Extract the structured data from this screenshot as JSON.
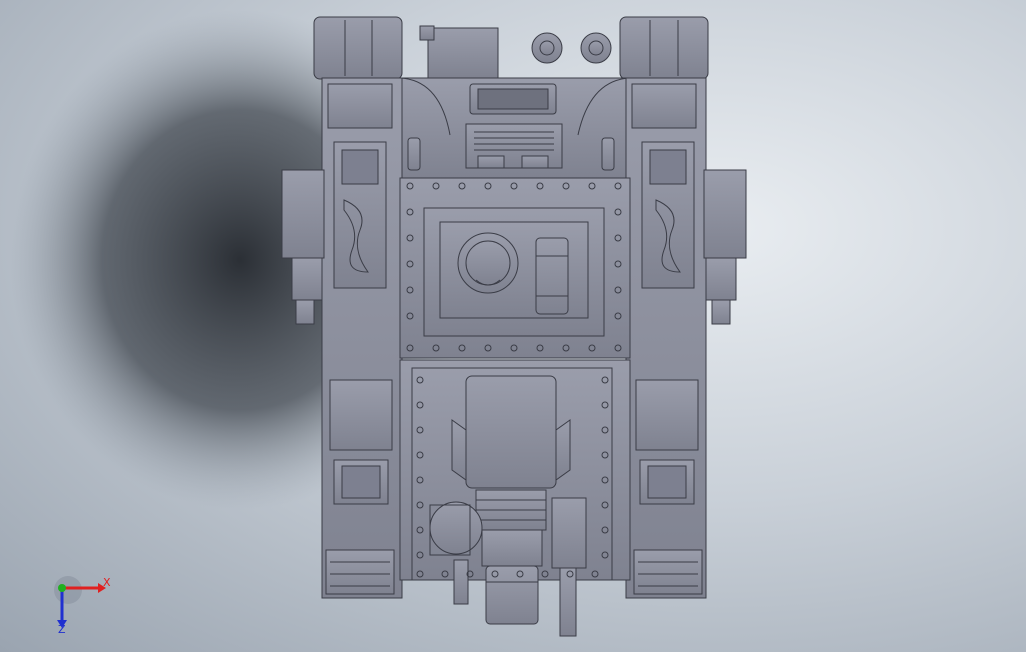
{
  "viewport": {
    "background_top": "#e9edf1",
    "background_bottom": "#9aa4b0",
    "shadow_color": "#2c3138",
    "model_color": "#8c8f9c",
    "edge_color": "#3a3c46"
  },
  "model": {
    "icon": "tank-model-icon"
  },
  "triad": {
    "x_label": "X",
    "z_label": "Z",
    "x_color": "#e02020",
    "y_color": "#20b020",
    "z_color": "#2030d0"
  }
}
